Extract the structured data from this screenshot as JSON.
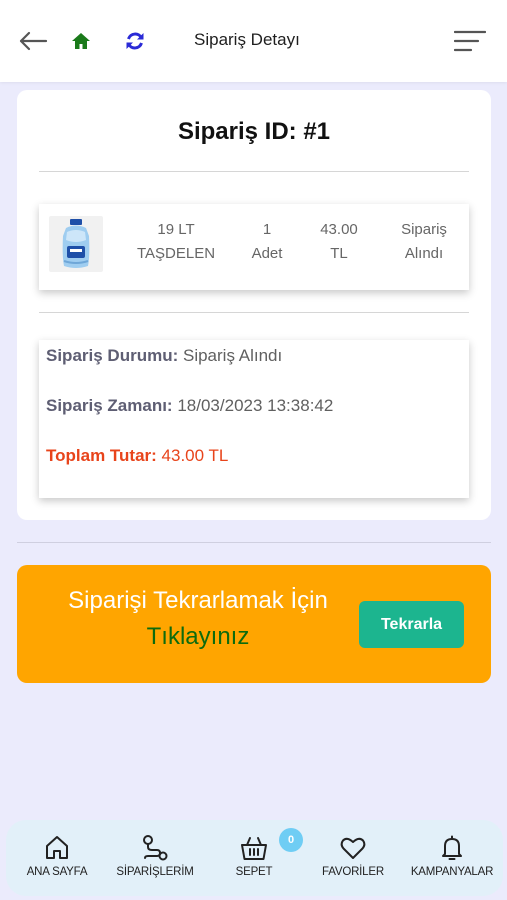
{
  "header": {
    "title": "Sipariş Detayı",
    "icons": [
      "back-arrow-icon",
      "home-icon",
      "refresh-icon",
      "menu-icon"
    ],
    "home_color": "#1a7a1a",
    "refresh_color": "#2a2ad6"
  },
  "order": {
    "id_label": "Sipariş ID: #1",
    "item": {
      "name_line1": "19 LT",
      "name_line2": "TAŞDELEN",
      "qty_line1": "1",
      "qty_line2": "Adet",
      "price_line1": "43.00",
      "price_line2": "TL",
      "status_line1": "Sipariş",
      "status_line2": "Alındı"
    },
    "details": {
      "status_label": "Sipariş Durumu:",
      "status_value": "Sipariş Alındı",
      "time_label": "Sipariş Zamanı:",
      "time_value": "18/03/2023 13:38:42",
      "total_label": "Toplam Tutar:",
      "total_value": "43.00 TL",
      "total_color": "#e8441b"
    }
  },
  "reorder": {
    "line1": "Siparişi Tekrarlamak İçin",
    "line2": "Tıklayınız",
    "button_label": "Tekrarla",
    "banner_color": "#ffa500",
    "button_color": "#1cb58f"
  },
  "bottom_nav": {
    "items": [
      {
        "label": "ANA SAYFA",
        "icon": "home-outline-icon"
      },
      {
        "label": "SİPARİŞLERİM",
        "icon": "route-icon"
      },
      {
        "label": "SEPET",
        "icon": "basket-icon"
      },
      {
        "label": "FAVORİLER",
        "icon": "heart-icon"
      },
      {
        "label": "KAMPANYALAR",
        "icon": "bell-icon"
      }
    ],
    "cart_count": "0"
  }
}
